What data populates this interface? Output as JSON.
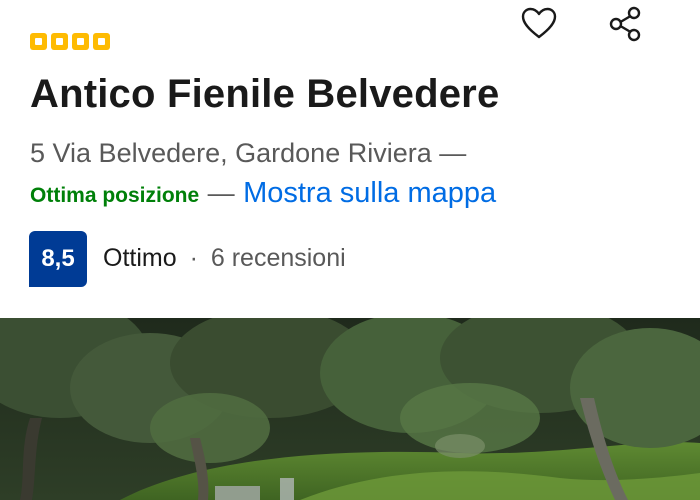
{
  "property": {
    "star_rating": 4,
    "name": "Antico Fienile Belvedere",
    "address": "5 Via Belvedere, Gardone Riviera —",
    "location_badge": "Ottima posizione",
    "separator": "—",
    "map_link": "Mostra sulla mappa"
  },
  "review": {
    "score": "8,5",
    "label": "Ottimo",
    "dot": "·",
    "count_text": "6 recensioni"
  },
  "actions": {
    "favorite_icon": "heart-icon",
    "share_icon": "share-icon"
  },
  "colors": {
    "star_yellow": "#febb02",
    "score_blue": "#003b95",
    "link_blue": "#006ce4",
    "green": "#008009"
  }
}
